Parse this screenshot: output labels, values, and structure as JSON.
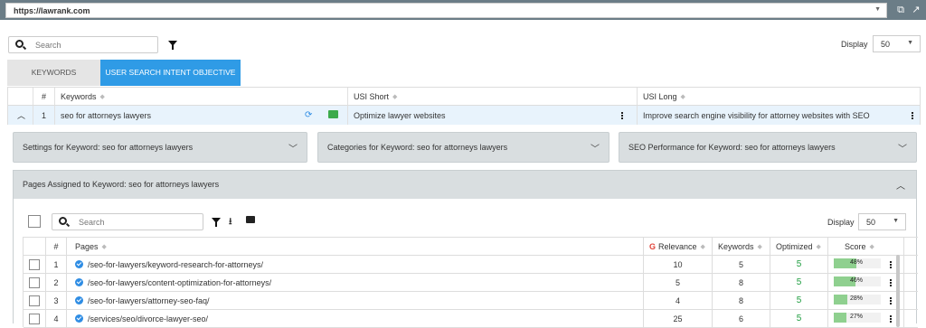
{
  "browser": {
    "url": "https://lawrank.com"
  },
  "toolbar": {
    "search_placeholder": "Search",
    "display_label": "Display",
    "display_value": "50"
  },
  "tabs": [
    {
      "label": "KEYWORDS"
    },
    {
      "label": "USER SEARCH INTENT OBJECTIVE"
    }
  ],
  "grid1": {
    "headers": {
      "num": "#",
      "keywords": "Keywords",
      "usi_short": "USI Short",
      "usi_long": "USI Long"
    },
    "row": {
      "num": "1",
      "keyword": "seo for attorneys lawyers",
      "usi_short": "Optimize lawyer websites",
      "usi_long": "Improve search engine visibility for attorney websites with SEO"
    }
  },
  "panels": [
    {
      "label": "Settings for Keyword: seo for attorneys lawyers"
    },
    {
      "label": "Categories for Keyword: seo for attorneys lawyers"
    },
    {
      "label": "SEO Performance for Keyword: seo for attorneys lawyers"
    }
  ],
  "pages_panel": {
    "title": "Pages Assigned to Keyword: seo for attorneys lawyers",
    "search_placeholder": "Search",
    "display_label": "Display",
    "display_value": "50",
    "headers": {
      "num": "#",
      "pages": "Pages",
      "relevance": "Relevance",
      "keywords": "Keywords",
      "optimized": "Optimized",
      "score": "Score"
    },
    "rows": [
      {
        "num": "1",
        "page": "/seo-for-lawyers/keyword-research-for-attorneys/",
        "relevance": "10",
        "keywords": "5",
        "optimized": "5",
        "score": "48%",
        "score_value": 48
      },
      {
        "num": "2",
        "page": "/seo-for-lawyers/content-optimization-for-attorneys/",
        "relevance": "5",
        "keywords": "8",
        "optimized": "5",
        "score": "46%",
        "score_value": 46
      },
      {
        "num": "3",
        "page": "/seo-for-lawyers/attorney-seo-faq/",
        "relevance": "4",
        "keywords": "8",
        "optimized": "5",
        "score": "28%",
        "score_value": 28
      },
      {
        "num": "4",
        "page": "/services/seo/divorce-lawyer-seo/",
        "relevance": "25",
        "keywords": "6",
        "optimized": "5",
        "score": "27%",
        "score_value": 27
      }
    ]
  },
  "colors": {
    "accent": "#2f9be6",
    "score_fill": "#8fd08f",
    "optimized": "#1e9d3f",
    "google": "#e0443a"
  }
}
